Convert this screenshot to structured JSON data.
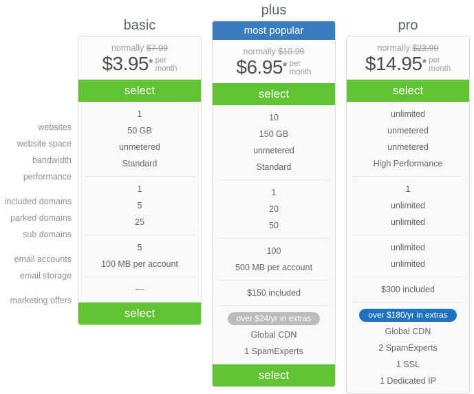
{
  "row_labels": [
    {
      "group": 0,
      "label": "websites"
    },
    {
      "group": 0,
      "label": "website space"
    },
    {
      "group": 0,
      "label": "bandwidth"
    },
    {
      "group": 0,
      "label": "performance"
    },
    {
      "group": 1,
      "label": "included domains"
    },
    {
      "group": 1,
      "label": "parked domains"
    },
    {
      "group": 1,
      "label": "sub domains"
    },
    {
      "group": 2,
      "label": "email accounts"
    },
    {
      "group": 2,
      "label": "email storage"
    },
    {
      "group": 3,
      "label": "marketing offers"
    }
  ],
  "colors": {
    "green": "#5fc332",
    "blue": "#3a7cbe",
    "badge_gray": "#bcbcbc",
    "badge_blue": "#1d72c4",
    "card_bg": "#f9f9f9",
    "text": "#60666b",
    "muted": "#9aa0a5"
  },
  "labels": {
    "normally": "normally",
    "per": "per",
    "month": "month",
    "star": "*",
    "select": "select",
    "dash": "—"
  },
  "plans": [
    {
      "id": "basic",
      "title": "basic",
      "ribbon": null,
      "was_price": "$7.99",
      "price": "$3.95",
      "groups": [
        [
          "1",
          "50 GB",
          "unmetered",
          "Standard"
        ],
        [
          "1",
          "5",
          "25"
        ],
        [
          "5",
          "100 MB per account"
        ],
        [
          "—"
        ]
      ],
      "badge": null,
      "extras": []
    },
    {
      "id": "plus",
      "title": "plus",
      "ribbon": "most popular",
      "was_price": "$10.99",
      "price": "$6.95",
      "groups": [
        [
          "10",
          "150 GB",
          "unmetered",
          "Standard"
        ],
        [
          "1",
          "20",
          "50"
        ],
        [
          "100",
          "500 MB per account"
        ],
        [
          "$150 included"
        ]
      ],
      "badge": "over $24/yr in extras",
      "extras": [
        "Global CDN",
        "1 SpamExperts"
      ]
    },
    {
      "id": "pro",
      "title": "pro",
      "ribbon": null,
      "was_price": "$23.99",
      "price": "$14.95",
      "groups": [
        [
          "unlimited",
          "unmetered",
          "unmetered",
          "High Performance"
        ],
        [
          "1",
          "unlimited",
          "unlimited"
        ],
        [
          "unlimited",
          "unlimited"
        ],
        [
          "$300 included"
        ]
      ],
      "badge": "over $180/yr in extras",
      "extras": [
        "Global CDN",
        "2 SpamExperts",
        "1 SSL",
        "1 Dedicated IP"
      ]
    }
  ]
}
